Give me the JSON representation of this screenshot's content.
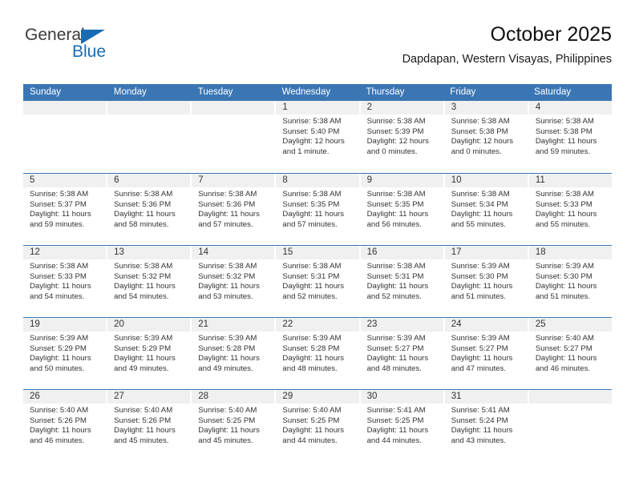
{
  "brand": {
    "name_top": "General",
    "name_bottom": "Blue",
    "accent_color": "#176cb4",
    "triangle_icon": "brand-triangle-icon"
  },
  "header": {
    "title": "October 2025",
    "subtitle": "Dapdapan, Western Visayas, Philippines"
  },
  "colors": {
    "header_blue": "#3b76b4",
    "daynum_strip": "#f0f0f0",
    "text": "#333333"
  },
  "calendar": {
    "weekdays": [
      "Sunday",
      "Monday",
      "Tuesday",
      "Wednesday",
      "Thursday",
      "Friday",
      "Saturday"
    ],
    "weeks": [
      [
        {
          "day": "",
          "sunrise": "",
          "sunset": "",
          "daylight": "",
          "empty": true
        },
        {
          "day": "",
          "sunrise": "",
          "sunset": "",
          "daylight": "",
          "empty": true
        },
        {
          "day": "",
          "sunrise": "",
          "sunset": "",
          "daylight": "",
          "empty": true
        },
        {
          "day": "1",
          "sunrise": "Sunrise: 5:38 AM",
          "sunset": "Sunset: 5:40 PM",
          "daylight": "Daylight: 12 hours and 1 minute."
        },
        {
          "day": "2",
          "sunrise": "Sunrise: 5:38 AM",
          "sunset": "Sunset: 5:39 PM",
          "daylight": "Daylight: 12 hours and 0 minutes."
        },
        {
          "day": "3",
          "sunrise": "Sunrise: 5:38 AM",
          "sunset": "Sunset: 5:38 PM",
          "daylight": "Daylight: 12 hours and 0 minutes."
        },
        {
          "day": "4",
          "sunrise": "Sunrise: 5:38 AM",
          "sunset": "Sunset: 5:38 PM",
          "daylight": "Daylight: 11 hours and 59 minutes."
        }
      ],
      [
        {
          "day": "5",
          "sunrise": "Sunrise: 5:38 AM",
          "sunset": "Sunset: 5:37 PM",
          "daylight": "Daylight: 11 hours and 59 minutes."
        },
        {
          "day": "6",
          "sunrise": "Sunrise: 5:38 AM",
          "sunset": "Sunset: 5:36 PM",
          "daylight": "Daylight: 11 hours and 58 minutes."
        },
        {
          "day": "7",
          "sunrise": "Sunrise: 5:38 AM",
          "sunset": "Sunset: 5:36 PM",
          "daylight": "Daylight: 11 hours and 57 minutes."
        },
        {
          "day": "8",
          "sunrise": "Sunrise: 5:38 AM",
          "sunset": "Sunset: 5:35 PM",
          "daylight": "Daylight: 11 hours and 57 minutes."
        },
        {
          "day": "9",
          "sunrise": "Sunrise: 5:38 AM",
          "sunset": "Sunset: 5:35 PM",
          "daylight": "Daylight: 11 hours and 56 minutes."
        },
        {
          "day": "10",
          "sunrise": "Sunrise: 5:38 AM",
          "sunset": "Sunset: 5:34 PM",
          "daylight": "Daylight: 11 hours and 55 minutes."
        },
        {
          "day": "11",
          "sunrise": "Sunrise: 5:38 AM",
          "sunset": "Sunset: 5:33 PM",
          "daylight": "Daylight: 11 hours and 55 minutes."
        }
      ],
      [
        {
          "day": "12",
          "sunrise": "Sunrise: 5:38 AM",
          "sunset": "Sunset: 5:33 PM",
          "daylight": "Daylight: 11 hours and 54 minutes."
        },
        {
          "day": "13",
          "sunrise": "Sunrise: 5:38 AM",
          "sunset": "Sunset: 5:32 PM",
          "daylight": "Daylight: 11 hours and 54 minutes."
        },
        {
          "day": "14",
          "sunrise": "Sunrise: 5:38 AM",
          "sunset": "Sunset: 5:32 PM",
          "daylight": "Daylight: 11 hours and 53 minutes."
        },
        {
          "day": "15",
          "sunrise": "Sunrise: 5:38 AM",
          "sunset": "Sunset: 5:31 PM",
          "daylight": "Daylight: 11 hours and 52 minutes."
        },
        {
          "day": "16",
          "sunrise": "Sunrise: 5:38 AM",
          "sunset": "Sunset: 5:31 PM",
          "daylight": "Daylight: 11 hours and 52 minutes."
        },
        {
          "day": "17",
          "sunrise": "Sunrise: 5:39 AM",
          "sunset": "Sunset: 5:30 PM",
          "daylight": "Daylight: 11 hours and 51 minutes."
        },
        {
          "day": "18",
          "sunrise": "Sunrise: 5:39 AM",
          "sunset": "Sunset: 5:30 PM",
          "daylight": "Daylight: 11 hours and 51 minutes."
        }
      ],
      [
        {
          "day": "19",
          "sunrise": "Sunrise: 5:39 AM",
          "sunset": "Sunset: 5:29 PM",
          "daylight": "Daylight: 11 hours and 50 minutes."
        },
        {
          "day": "20",
          "sunrise": "Sunrise: 5:39 AM",
          "sunset": "Sunset: 5:29 PM",
          "daylight": "Daylight: 11 hours and 49 minutes."
        },
        {
          "day": "21",
          "sunrise": "Sunrise: 5:39 AM",
          "sunset": "Sunset: 5:28 PM",
          "daylight": "Daylight: 11 hours and 49 minutes."
        },
        {
          "day": "22",
          "sunrise": "Sunrise: 5:39 AM",
          "sunset": "Sunset: 5:28 PM",
          "daylight": "Daylight: 11 hours and 48 minutes."
        },
        {
          "day": "23",
          "sunrise": "Sunrise: 5:39 AM",
          "sunset": "Sunset: 5:27 PM",
          "daylight": "Daylight: 11 hours and 48 minutes."
        },
        {
          "day": "24",
          "sunrise": "Sunrise: 5:39 AM",
          "sunset": "Sunset: 5:27 PM",
          "daylight": "Daylight: 11 hours and 47 minutes."
        },
        {
          "day": "25",
          "sunrise": "Sunrise: 5:40 AM",
          "sunset": "Sunset: 5:27 PM",
          "daylight": "Daylight: 11 hours and 46 minutes."
        }
      ],
      [
        {
          "day": "26",
          "sunrise": "Sunrise: 5:40 AM",
          "sunset": "Sunset: 5:26 PM",
          "daylight": "Daylight: 11 hours and 46 minutes."
        },
        {
          "day": "27",
          "sunrise": "Sunrise: 5:40 AM",
          "sunset": "Sunset: 5:26 PM",
          "daylight": "Daylight: 11 hours and 45 minutes."
        },
        {
          "day": "28",
          "sunrise": "Sunrise: 5:40 AM",
          "sunset": "Sunset: 5:25 PM",
          "daylight": "Daylight: 11 hours and 45 minutes."
        },
        {
          "day": "29",
          "sunrise": "Sunrise: 5:40 AM",
          "sunset": "Sunset: 5:25 PM",
          "daylight": "Daylight: 11 hours and 44 minutes."
        },
        {
          "day": "30",
          "sunrise": "Sunrise: 5:41 AM",
          "sunset": "Sunset: 5:25 PM",
          "daylight": "Daylight: 11 hours and 44 minutes."
        },
        {
          "day": "31",
          "sunrise": "Sunrise: 5:41 AM",
          "sunset": "Sunset: 5:24 PM",
          "daylight": "Daylight: 11 hours and 43 minutes."
        },
        {
          "day": "",
          "sunrise": "",
          "sunset": "",
          "daylight": "",
          "empty": true
        }
      ]
    ]
  }
}
